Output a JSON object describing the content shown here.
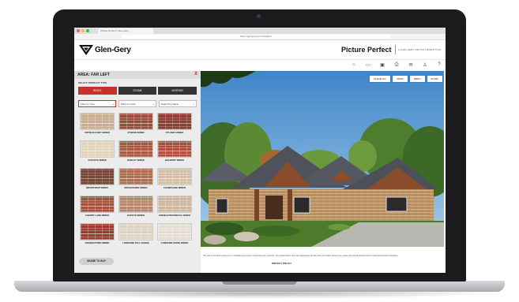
{
  "browser": {
    "tab_title": "Picture Perfect | Glen-Gery",
    "url": "https://glengery.com/visualizer"
  },
  "header": {
    "logo_text": "Glen-Gery",
    "app_title": "Picture Perfect",
    "tagline": "A GLEN-GERY VIRTUAL DESIGN TOOL"
  },
  "toolbar_icons": [
    "home-icon",
    "folder-icon",
    "save-icon",
    "print-icon",
    "email-icon",
    "user-icon",
    "help-icon"
  ],
  "panel": {
    "area_title": "AREA: FAR LEFT",
    "close": "X",
    "select_label": "SELECT PRODUCT TYPE",
    "tabs": [
      {
        "label": "BRICK"
      },
      {
        "label": "STONE"
      },
      {
        "label": "MORTAR"
      }
    ],
    "filters": [
      {
        "label": "Filter by Type",
        "icon": "+"
      },
      {
        "label": "Filter by Color",
        "icon": "+"
      },
      {
        "label": "Search by Name",
        "icon": "⌕"
      }
    ],
    "swatches": [
      {
        "name": "ANTIQUE IVORY WIRED",
        "color": "#c9ad8d",
        "mortar": "#e7ddd0"
      },
      {
        "name": "ATHENS WIRED",
        "color": "#9a4a3a",
        "mortar": "#c8b9aa"
      },
      {
        "name": "ATLANTA WIRED",
        "color": "#8e3b33",
        "mortar": "#b9a595"
      },
      {
        "name": "AUGUSTA WIRED",
        "color": "#e2d3bb",
        "mortar": "#f1eadf"
      },
      {
        "name": "BARLEY WIRED",
        "color": "#a85a3e",
        "mortar": "#cdbba8"
      },
      {
        "name": "BELMONT WIRED",
        "color": "#b04c3c",
        "mortar": "#d0c0b0"
      },
      {
        "name": "BROOKVIEW WIRED",
        "color": "#7b4636",
        "mortar": "#a69384"
      },
      {
        "name": "BROOKSHIRE WIRED",
        "color": "#b06c4c",
        "mortar": "#d6c5b3"
      },
      {
        "name": "CHAMPAGNE WIRED",
        "color": "#d2bfa6",
        "mortar": "#ece3d6"
      },
      {
        "name": "CHERRY LANE WIRED",
        "color": "#a4523e",
        "mortar": "#cbb8a6"
      },
      {
        "name": "DAKOTA WIRED",
        "color": "#b6876a",
        "mortar": "#dccdbd"
      },
      {
        "name": "FRENCH PROVINCIAL WIRED",
        "color": "#cdb69e",
        "mortar": "#e9e0d4"
      },
      {
        "name": "GEORGETOWN WIRED",
        "color": "#9b3a33",
        "mortar": "#c6b2a2"
      },
      {
        "name": "LORRAINE FULL RANGE",
        "color": "#ddd2c2",
        "mortar": "#f2ede6"
      },
      {
        "name": "LORRAINE WHITE WIRED",
        "color": "#e6ddd2",
        "mortar": "#f6f2ec"
      }
    ],
    "share_label": "SHARE TO BUY"
  },
  "view_controls": [
    "CLEAR ALL",
    "UNDO",
    "REDO",
    "ZOOM"
  ],
  "footer": {
    "disclaimer": "This tool is intended to assist you in visualizing your project using Glen-Gery products. The actual product and color appearance will vary from the images shown here; please view actual samples before making final product selections.",
    "privacy": "PRIVACY POLICY"
  },
  "colors": {
    "accent": "#c8302a",
    "tab_dark": "#333333",
    "panel_bg": "#ececec"
  }
}
